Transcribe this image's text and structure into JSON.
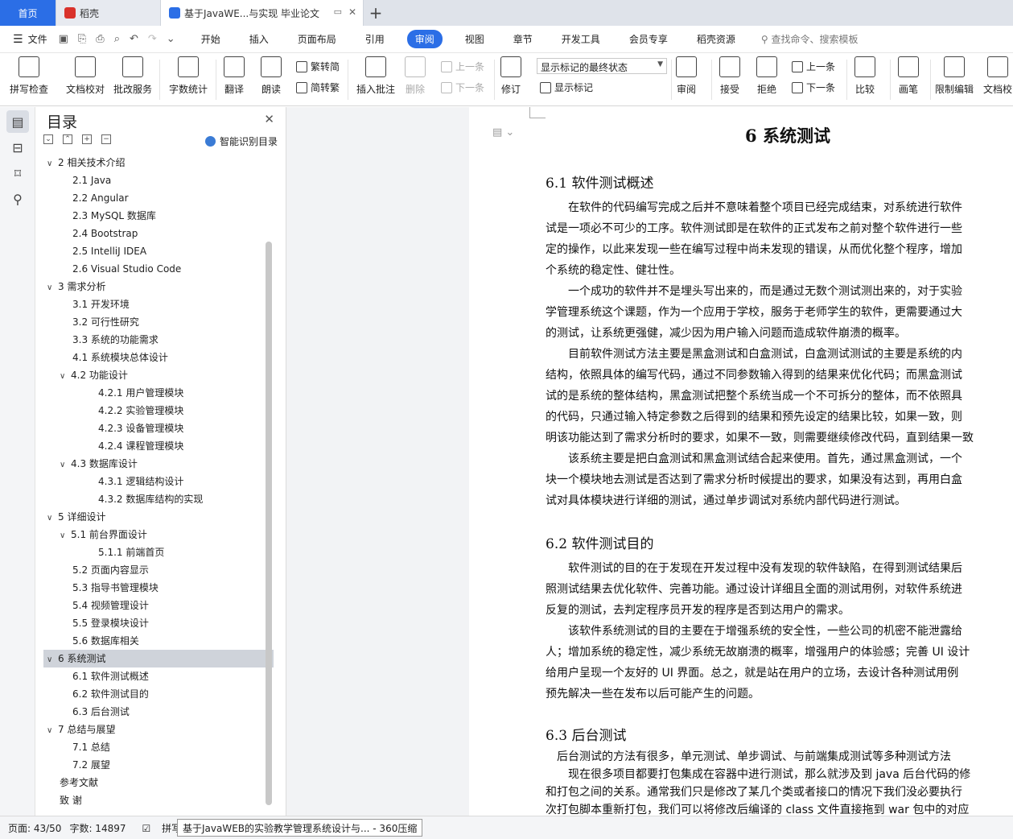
{
  "tabs": {
    "home": "首页",
    "daoke": "稻壳",
    "doc": "基于JavaWE...与实现 毕业论文",
    "new_tab": "+"
  },
  "menu": {
    "file": "文件",
    "items": [
      "开始",
      "插入",
      "页面布局",
      "引用",
      "审阅",
      "视图",
      "章节",
      "开发工具",
      "会员专享",
      "稻壳资源"
    ],
    "active_index": 4,
    "search": "查找命令、搜索模板"
  },
  "ribbon": {
    "spell_check": "拼写检查",
    "doc_proof": "文档校对",
    "batch_service": "批改服务",
    "word_count": "字数统计",
    "translate": "翻译",
    "read_aloud": "朗读",
    "trad_to_simp": "繁转简",
    "simp_to_trad": "简转繁",
    "insert_comment": "插入批注",
    "delete": "删除",
    "prev_comment": "上一条",
    "next_comment": "下一条",
    "track_changes": "修订",
    "display_mode": "显示标记的最终状态",
    "show_marks": "显示标记",
    "review": "审阅",
    "accept": "接受",
    "reject": "拒绝",
    "prev_change": "上一条",
    "next_change": "下一条",
    "compare": "比较",
    "pen": "画笔",
    "restrict_edit": "限制编辑",
    "doc_check": "文档校"
  },
  "toc": {
    "title": "目录",
    "smart_label": "智能识别目录",
    "items": [
      {
        "text": "2  相关技术介绍",
        "level": 1,
        "caret": "v"
      },
      {
        "text": "2.1 Java",
        "level": 2
      },
      {
        "text": "2.2 Angular",
        "level": 2
      },
      {
        "text": "2.3 MySQL 数据库",
        "level": 2
      },
      {
        "text": "2.4 Bootstrap",
        "level": 2
      },
      {
        "text": "2.5 IntelliJ IDEA",
        "level": 2
      },
      {
        "text": "2.6 Visual Studio Code",
        "level": 2
      },
      {
        "text": "3  需求分析",
        "level": 1,
        "caret": "v"
      },
      {
        "text": "3.1  开发环境",
        "level": 2
      },
      {
        "text": "3.2  可行性研究",
        "level": 2
      },
      {
        "text": "3.3  系统的功能需求",
        "level": 2
      },
      {
        "text": "4.1  系统模块总体设计",
        "level": 2
      },
      {
        "text": "4.2  功能设计",
        "level": 2,
        "caret": "v"
      },
      {
        "text": "4.2.1  用户管理模块",
        "level": 3
      },
      {
        "text": "4.2.2  实验管理模块",
        "level": 3
      },
      {
        "text": "4.2.3  设备管理模块",
        "level": 3
      },
      {
        "text": "4.2.4  课程管理模块",
        "level": 3
      },
      {
        "text": "4.3  数据库设计",
        "level": 2,
        "caret": "v"
      },
      {
        "text": "4.3.1 逻辑结构设计",
        "level": 3
      },
      {
        "text": "4.3.2 数据库结构的实现",
        "level": 3
      },
      {
        "text": "5  详细设计",
        "level": 1,
        "caret": "v"
      },
      {
        "text": "5.1  前台界面设计",
        "level": 2,
        "caret": "v"
      },
      {
        "text": "5.1.1 前端首页",
        "level": 3
      },
      {
        "text": "5.2  页面内容显示",
        "level": 2
      },
      {
        "text": "5.3  指导书管理模块",
        "level": 2
      },
      {
        "text": "5.4  视频管理设计",
        "level": 2
      },
      {
        "text": "5.5  登录模块设计",
        "level": 2
      },
      {
        "text": "5.6  数据库相关",
        "level": 2
      },
      {
        "text": "6  系统测试",
        "level": 1,
        "caret": "v",
        "selected": true
      },
      {
        "text": "6.1  软件测试概述",
        "level": 2
      },
      {
        "text": "6.2  软件测试目的",
        "level": 2
      },
      {
        "text": "6.3 后台测试",
        "level": 2
      },
      {
        "text": "7  总结与展望",
        "level": 1,
        "caret": "v"
      },
      {
        "text": "7.1  总结",
        "level": 2
      },
      {
        "text": "7.2  展望",
        "level": 2
      },
      {
        "text": "参考文献",
        "level": 0
      },
      {
        "text": "致    谢",
        "level": 0
      }
    ]
  },
  "document": {
    "chapter_title": "6  系统测试",
    "sections": [
      {
        "heading": "6.1  软件测试概述",
        "lines": [
          "　　在软件的代码编写完成之后并不意味着整个项目已经完成结束，对系统进行软件",
          "试是一项必不可少的工序。软件测试即是在软件的正式发布之前对整个软件进行一些",
          "定的操作，以此来发现一些在编写过程中尚未发现的错误，从而优化整个程序，增加",
          "个系统的稳定性、健壮性。",
          "　　一个成功的软件并不是埋头写出来的，而是通过无数个测试测出来的，对于实验",
          "学管理系统这个课题，作为一个应用于学校，服务于老师学生的软件，更需要通过大",
          "的测试，让系统更强健，减少因为用户输入问题而造成软件崩溃的概率。",
          "　　目前软件测试方法主要是黑盒测试和白盒测试，白盒测试测试的主要是系统的内",
          "结构，依照具体的编写代码，通过不同参数输入得到的结果来优化代码；而黑盒测试",
          "试的是系统的整体结构，黑盒测试把整个系统当成一个不可拆分的整体，而不依照具",
          "的代码，只通过输入特定参数之后得到的结果和预先设定的结果比较，如果一致，则",
          "明该功能达到了需求分析时的要求，如果不一致，则需要继续修改代码，直到结果一致",
          "　　该系统主要是把白盒测试和黑盒测试结合起来使用。首先，通过黑盒测试，一个",
          "块一个模块地去测试是否达到了需求分析时候提出的要求，如果没有达到，再用白盒",
          "试对具体模块进行详细的测试，通过单步调试对系统内部代码进行测试。"
        ]
      },
      {
        "heading": "6.2  软件测试目的",
        "lines": [
          "　　软件测试的目的在于发现在开发过程中没有发现的软件缺陷，在得到测试结果后",
          "照测试结果去优化软件、完善功能。通过设计详细且全面的测试用例，对软件系统进",
          "反复的测试，去判定程序员开发的程序是否到达用户的需求。",
          "　　该软件系统测试的目的主要在于增强系统的安全性，一些公司的机密不能泄露给",
          "人；增加系统的稳定性，减少系统无故崩溃的概率，增强用户的体验感；完善 UI 设计",
          "给用户呈现一个友好的 UI 界面。总之，就是站在用户的立场，去设计各种测试用例",
          "预先解决一些在发布以后可能产生的问题。"
        ]
      },
      {
        "heading": "6.3 后台测试",
        "lines": [
          "　后台测试的方法有很多，单元测试、单步调试、与前端集成测试等多种测试方法",
          "　　现在很多项目都要打包集成在容器中进行测试，那么就涉及到 java 后台代码的修",
          "和打包之间的关系。通常我们只是修改了某几个类或者接口的情况下我们没必要执行",
          "次打包脚本重新打包，我们可以将修改后编译的 class 文件直接拖到 war 包中的对应"
        ]
      }
    ]
  },
  "status": {
    "page": "页面: 43/50",
    "words": "字数: 14897",
    "spell": "拼写检",
    "tooltip": "基于JavaWEB的实验教学管理系统设计与... - 360压缩"
  }
}
